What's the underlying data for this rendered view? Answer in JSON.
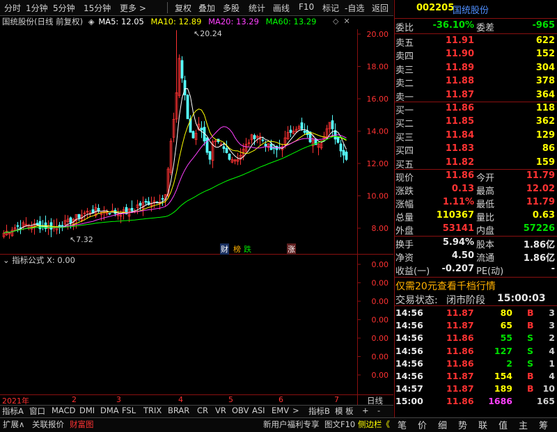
{
  "toolbar": {
    "items": [
      "分时",
      "1分钟",
      "5分钟",
      "15分钟",
      "更多 >",
      "复权",
      "叠加",
      "多股",
      "统计",
      "画线",
      "F10",
      "标记",
      "-自选",
      "返回"
    ]
  },
  "chart_header": {
    "name": "国统股份(日线 前复权)",
    "ma5": "MA5: 12.05",
    "ma10": "MA10: 12.89",
    "ma20": "MA20: 13.29",
    "ma60": "MA60: 13.29",
    "colors": {
      "ma5": "#ffffff",
      "ma10": "#ffff00",
      "ma20": "#ff40ff",
      "ma60": "#00ff00"
    }
  },
  "price_axis": [
    "20.00",
    "18.00",
    "16.00",
    "14.00",
    "12.00",
    "10.00",
    "8.00"
  ],
  "annotations": {
    "high": "20.24",
    "low": "7.32"
  },
  "event_tags": {
    "cai": "财",
    "bang": "榜",
    "die": "跌",
    "zhang": "涨"
  },
  "indicator": {
    "title": "指标公式",
    "xval": "X: 0.00",
    "axis": [
      "0.00",
      "0.00",
      "0.00",
      "0.00",
      "0.00",
      "0.00",
      "0.00"
    ]
  },
  "date_axis": {
    "year": "2021年",
    "months": [
      "2",
      "3",
      "4",
      "5",
      "6",
      "7"
    ],
    "period": "日线"
  },
  "indicator_tabs": [
    "指标A",
    "窗口",
    "MACD",
    "DMI",
    "DMA",
    "FSL",
    "TRIX",
    "BRAR",
    "CR",
    "VR",
    "OBV",
    "ASI",
    "EMV",
    ">",
    "指标B",
    "模 板",
    "+",
    "-"
  ],
  "bottom_tabs": [
    "扩展∧",
    "关联报价",
    "财富图",
    "新用户福利专享",
    "图文F10",
    "侧边栏《"
  ],
  "nav_icons": [
    "笔",
    "价",
    "细",
    "势",
    "联",
    "值",
    "主",
    "筹"
  ],
  "stock": {
    "code": "002205",
    "name": "国统股份"
  },
  "weibi": {
    "label": "委比",
    "value": "-36.10%",
    "label2": "委差",
    "value2": "-965"
  },
  "sells": [
    {
      "label": "卖五",
      "price": "11.91",
      "vol": "622"
    },
    {
      "label": "卖四",
      "price": "11.90",
      "vol": "152"
    },
    {
      "label": "卖三",
      "price": "11.89",
      "vol": "304"
    },
    {
      "label": "卖二",
      "price": "11.88",
      "vol": "378"
    },
    {
      "label": "卖一",
      "price": "11.87",
      "vol": "364"
    }
  ],
  "buys": [
    {
      "label": "买一",
      "price": "11.86",
      "vol": "118"
    },
    {
      "label": "买二",
      "price": "11.85",
      "vol": "362"
    },
    {
      "label": "买三",
      "price": "11.84",
      "vol": "129"
    },
    {
      "label": "买四",
      "price": "11.83",
      "vol": "86"
    },
    {
      "label": "买五",
      "price": "11.82",
      "vol": "159"
    }
  ],
  "quote": [
    {
      "l": "现价",
      "v": "11.86",
      "l2": "今开",
      "v2": "11.79"
    },
    {
      "l": "涨跌",
      "v": "0.13",
      "l2": "最高",
      "v2": "12.02"
    },
    {
      "l": "涨幅",
      "v": "1.11%",
      "l2": "最低",
      "v2": "11.79"
    },
    {
      "l": "总量",
      "v": "110367",
      "l2": "量比",
      "v2": "0.63"
    },
    {
      "l": "外盘",
      "v": "53141",
      "l2": "内盘",
      "v2": "57226"
    }
  ],
  "stats": [
    {
      "l": "换手",
      "v": "5.94%",
      "l2": "股本",
      "v2": "1.86亿"
    },
    {
      "l": "净资",
      "v": "4.50",
      "l2": "流通",
      "v2": "1.86亿"
    },
    {
      "l": "收益(一)",
      "v": "-0.207",
      "l2": "PE(动)",
      "v2": "-"
    }
  ],
  "promo": "仅需20元查看千档行情",
  "trade_status": {
    "label": "交易状态:",
    "phase": "闭市阶段",
    "time": "15:00:03"
  },
  "ticks": [
    {
      "time": "14:56",
      "price": "11.87",
      "vol": "80",
      "bs": "B",
      "n": "3"
    },
    {
      "time": "14:56",
      "price": "11.87",
      "vol": "65",
      "bs": "B",
      "n": "3"
    },
    {
      "time": "14:56",
      "price": "11.86",
      "vol": "55",
      "bs": "S",
      "n": "2"
    },
    {
      "time": "14:56",
      "price": "11.86",
      "vol": "127",
      "bs": "S",
      "n": "4"
    },
    {
      "time": "14:56",
      "price": "11.86",
      "vol": "2",
      "bs": "S",
      "n": "1"
    },
    {
      "time": "14:56",
      "price": "11.87",
      "vol": "154",
      "bs": "B",
      "n": "4"
    },
    {
      "time": "14:57",
      "price": "11.87",
      "vol": "189",
      "bs": "B",
      "n": "10"
    },
    {
      "time": "15:00",
      "price": "11.86",
      "vol": "1686",
      "bs": "",
      "n": "165"
    }
  ]
}
